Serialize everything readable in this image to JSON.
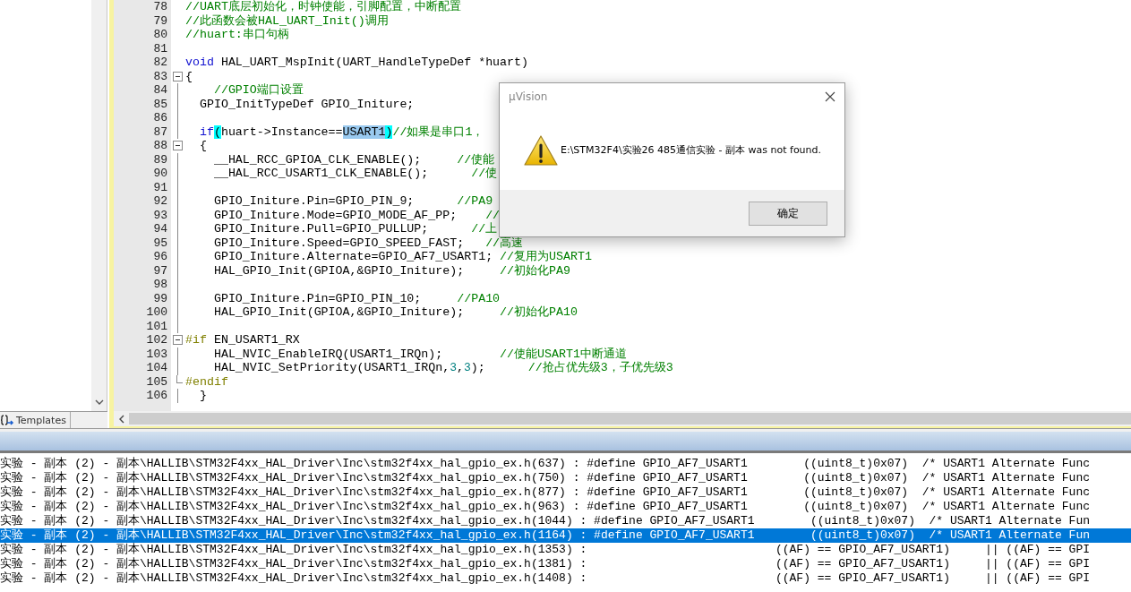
{
  "left_panel": {
    "tab": {
      "label": "Templates"
    }
  },
  "editor": {
    "lines": [
      {
        "number": "78",
        "segments": [
          {
            "text": "//UART底层初始化，时钟使能，引脚配置，中断配置",
            "kind": "comment"
          }
        ]
      },
      {
        "number": "79",
        "segments": [
          {
            "text": "//此函数会被HAL_UART_Init()调用",
            "kind": "comment"
          }
        ]
      },
      {
        "number": "80",
        "segments": [
          {
            "text": "//huart:串口句柄",
            "kind": "comment"
          }
        ]
      },
      {
        "number": "81"
      },
      {
        "number": "82",
        "segments": [
          {
            "text": "void",
            "kind": "keyword"
          },
          {
            "text": " HAL_UART_MspInit(UART_HandleTypeDef *huart)",
            "kind": "code"
          }
        ]
      },
      {
        "number": "83",
        "collapsible": true,
        "segments": [
          {
            "text": "{",
            "kind": "code"
          }
        ]
      },
      {
        "number": "84",
        "in_block": true,
        "segments": [
          {
            "text": "    //GPIO端口设置",
            "kind": "comment"
          }
        ]
      },
      {
        "number": "85",
        "in_block": true,
        "segments": [
          {
            "text": "  GPIO_InitTypeDef GPIO_Initure;",
            "kind": "code"
          }
        ]
      },
      {
        "number": "86",
        "in_block": true
      },
      {
        "number": "87",
        "in_block": true,
        "segments": [
          {
            "text": "  if",
            "kind": "keyword"
          },
          {
            "text": "(",
            "kind": "match"
          },
          {
            "text": "huart->Instance==",
            "kind": "code"
          },
          {
            "text": "USART1",
            "kind": "selected"
          },
          {
            "text": ")",
            "kind": "match"
          },
          {
            "text": "//如果是串口1，",
            "kind": "comment"
          }
        ]
      },
      {
        "number": "88",
        "collapsible": true,
        "segments": [
          {
            "text": "  {",
            "kind": "code"
          }
        ]
      },
      {
        "number": "89",
        "in_block": true,
        "segments": [
          {
            "text": "    __HAL_RCC_GPIOA_CLK_ENABLE();     ",
            "kind": "code"
          },
          {
            "text": "//使能",
            "kind": "comment"
          }
        ]
      },
      {
        "number": "90",
        "in_block": true,
        "segments": [
          {
            "text": "    __HAL_RCC_USART1_CLK_ENABLE();      ",
            "kind": "code"
          },
          {
            "text": "//使",
            "kind": "comment"
          }
        ]
      },
      {
        "number": "91",
        "in_block": true
      },
      {
        "number": "92",
        "in_block": true,
        "segments": [
          {
            "text": "    GPIO_Initure.Pin=GPIO_PIN_9;      ",
            "kind": "code"
          },
          {
            "text": "//PA9",
            "kind": "comment"
          }
        ]
      },
      {
        "number": "93",
        "in_block": true,
        "segments": [
          {
            "text": "    GPIO_Initure.Mode=GPIO_MODE_AF_PP;    ",
            "kind": "code"
          },
          {
            "text": "//",
            "kind": "comment"
          }
        ]
      },
      {
        "number": "94",
        "in_block": true,
        "segments": [
          {
            "text": "    GPIO_Initure.Pull=GPIO_PULLUP;      ",
            "kind": "code"
          },
          {
            "text": "//上",
            "kind": "comment"
          }
        ]
      },
      {
        "number": "95",
        "in_block": true,
        "segments": [
          {
            "text": "    GPIO_Initure.Speed=GPIO_SPEED_FAST;   ",
            "kind": "code"
          },
          {
            "text": "//高速",
            "kind": "comment"
          }
        ]
      },
      {
        "number": "96",
        "in_block": true,
        "segments": [
          {
            "text": "    GPIO_Initure.Alternate=GPIO_AF7_USART1; ",
            "kind": "code"
          },
          {
            "text": "//复用为USART1",
            "kind": "comment"
          }
        ]
      },
      {
        "number": "97",
        "in_block": true,
        "segments": [
          {
            "text": "    HAL_GPIO_Init(GPIOA,&GPIO_Initure);     ",
            "kind": "code"
          },
          {
            "text": "//初始化PA9",
            "kind": "comment"
          }
        ]
      },
      {
        "number": "98",
        "in_block": true
      },
      {
        "number": "99",
        "in_block": true,
        "segments": [
          {
            "text": "    GPIO_Initure.Pin=GPIO_PIN_10;     ",
            "kind": "code"
          },
          {
            "text": "//PA10",
            "kind": "comment"
          }
        ]
      },
      {
        "number": "100",
        "in_block": true,
        "segments": [
          {
            "text": "    HAL_GPIO_Init(GPIOA,&GPIO_Initure);     ",
            "kind": "code"
          },
          {
            "text": "//初始化PA10",
            "kind": "comment"
          }
        ]
      },
      {
        "number": "101",
        "in_block": true
      },
      {
        "number": "102",
        "collapsible": true,
        "segments": [
          {
            "text": "#if",
            "kind": "preproc"
          },
          {
            "text": " EN_USART1_RX",
            "kind": "code"
          }
        ]
      },
      {
        "number": "103",
        "in_block": true,
        "segments": [
          {
            "text": "    HAL_NVIC_EnableIRQ(USART1_IRQn);        ",
            "kind": "code"
          },
          {
            "text": "//使能USART1中断通道",
            "kind": "comment"
          }
        ]
      },
      {
        "number": "104",
        "in_block": true,
        "segments": [
          {
            "text": "    HAL_NVIC_SetPriority(USART1_IRQn,",
            "kind": "code"
          },
          {
            "text": "3",
            "kind": "number"
          },
          {
            "text": ",",
            "kind": "code"
          },
          {
            "text": "3",
            "kind": "number"
          },
          {
            "text": ");      ",
            "kind": "code"
          },
          {
            "text": "//抢占优先级3，子优先级3",
            "kind": "comment"
          }
        ]
      },
      {
        "number": "105",
        "block_end": true,
        "segments": [
          {
            "text": "#endif",
            "kind": "preproc"
          }
        ]
      },
      {
        "number": "106",
        "in_block": true,
        "segments": [
          {
            "text": "  }",
            "kind": "code"
          }
        ]
      }
    ]
  },
  "dialog": {
    "title": "µVision",
    "message": "E:\\STM32F4\\实验26 485通信实验 - 副本 was not found.",
    "button": "确定"
  },
  "output": {
    "rows": [
      {
        "text": "实验 - 副本 (2) - 副本\\HALLIB\\STM32F4xx_HAL_Driver\\Inc\\stm32f4xx_hal_gpio_ex.h(637) : #define GPIO_AF7_USART1        ((uint8_t)0x07)  /* USART1 Alternate Func",
        "selected": false
      },
      {
        "text": "实验 - 副本 (2) - 副本\\HALLIB\\STM32F4xx_HAL_Driver\\Inc\\stm32f4xx_hal_gpio_ex.h(750) : #define GPIO_AF7_USART1        ((uint8_t)0x07)  /* USART1 Alternate Func",
        "selected": false
      },
      {
        "text": "实验 - 副本 (2) - 副本\\HALLIB\\STM32F4xx_HAL_Driver\\Inc\\stm32f4xx_hal_gpio_ex.h(877) : #define GPIO_AF7_USART1        ((uint8_t)0x07)  /* USART1 Alternate Func",
        "selected": false
      },
      {
        "text": "实验 - 副本 (2) - 副本\\HALLIB\\STM32F4xx_HAL_Driver\\Inc\\stm32f4xx_hal_gpio_ex.h(963) : #define GPIO_AF7_USART1        ((uint8_t)0x07)  /* USART1 Alternate Func",
        "selected": false
      },
      {
        "text": "实验 - 副本 (2) - 副本\\HALLIB\\STM32F4xx_HAL_Driver\\Inc\\stm32f4xx_hal_gpio_ex.h(1044) : #define GPIO_AF7_USART1        ((uint8_t)0x07)  /* USART1 Alternate Fun",
        "selected": false
      },
      {
        "text": "实验 - 副本 (2) - 副本\\HALLIB\\STM32F4xx_HAL_Driver\\Inc\\stm32f4xx_hal_gpio_ex.h(1164) : #define GPIO_AF7_USART1        ((uint8_t)0x07)  /* USART1 Alternate Fun",
        "selected": true
      },
      {
        "text": "实验 - 副本 (2) - 副本\\HALLIB\\STM32F4xx_HAL_Driver\\Inc\\stm32f4xx_hal_gpio_ex.h(1353) :                           ((AF) == GPIO_AF7_USART1)     || ((AF) == GPI",
        "selected": false
      },
      {
        "text": "实验 - 副本 (2) - 副本\\HALLIB\\STM32F4xx_HAL_Driver\\Inc\\stm32f4xx_hal_gpio_ex.h(1381) :                           ((AF) == GPIO_AF7_USART1)     || ((AF) == GPI",
        "selected": false
      },
      {
        "text": "实验 - 副本 (2) - 副本\\HALLIB\\STM32F4xx_HAL_Driver\\Inc\\stm32f4xx_hal_gpio_ex.h(1408) :                           ((AF) == GPIO_AF7_USART1)     || ((AF) == GPI",
        "selected": false
      }
    ]
  }
}
